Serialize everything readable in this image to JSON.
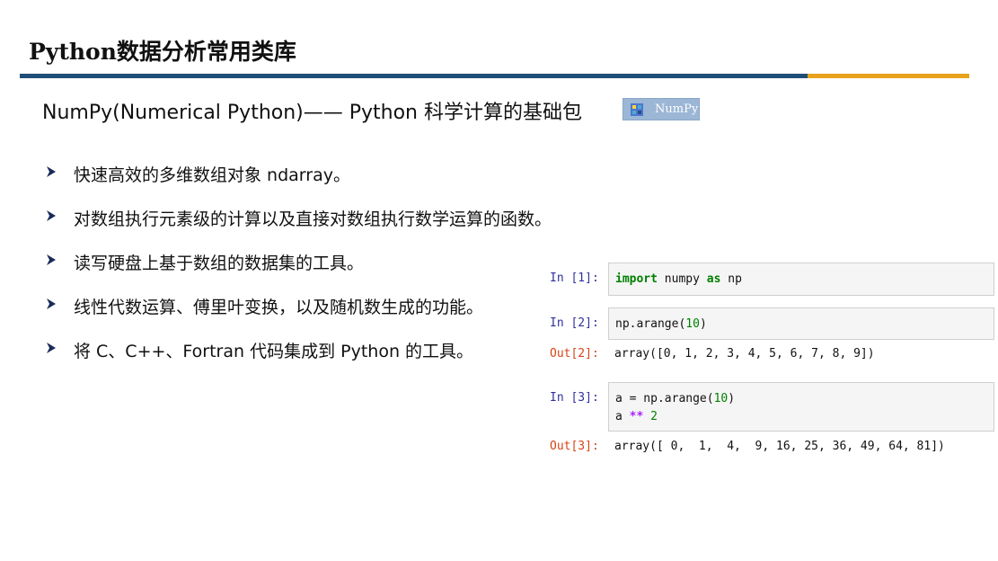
{
  "slide": {
    "title": "Python数据分析常用类库",
    "subtitle": "NumPy(Numerical Python)—— Python 科学计算的基础包",
    "badge_label": "NumPy",
    "colors": {
      "rule_primary": "#1f4e79",
      "rule_accent": "#e8a21c"
    }
  },
  "bullets": [
    {
      "icon": "arrow-bullet-icon",
      "text": "快速高效的多维数组对象 ndarray。"
    },
    {
      "icon": "arrow-bullet-icon",
      "text": "对数组执行元素级的计算以及直接对数组执行数学运算的函数。"
    },
    {
      "icon": "arrow-bullet-icon",
      "text": "读写硬盘上基于数组的数据集的工具。"
    },
    {
      "icon": "arrow-bullet-icon",
      "text": "线性代数运算、傅里叶变换，以及随机数生成的功能。"
    },
    {
      "icon": "arrow-bullet-icon",
      "text": "将 C、C++、Fortran 代码集成到 Python 的工具。"
    }
  ],
  "notebook": {
    "cells": [
      {
        "in_prompt": "In [1]:",
        "code": [
          "import numpy as np"
        ]
      },
      {
        "in_prompt": "In [2]:",
        "code": [
          "np.arange(10)"
        ],
        "out_prompt": "Out[2]:",
        "output": "array([0, 1, 2, 3, 4, 5, 6, 7, 8, 9])"
      },
      {
        "in_prompt": "In [3]:",
        "code": [
          "a = np.arange(10)",
          "a ** 2"
        ],
        "out_prompt": "Out[3]:",
        "output": "array([ 0,  1,  4,  9, 16, 25, 36, 49, 64, 81])"
      }
    ],
    "colors": {
      "in_prompt": "#30309f",
      "out_prompt": "#d84315",
      "keyword": "#008000",
      "operator": "#aa22ff"
    }
  }
}
